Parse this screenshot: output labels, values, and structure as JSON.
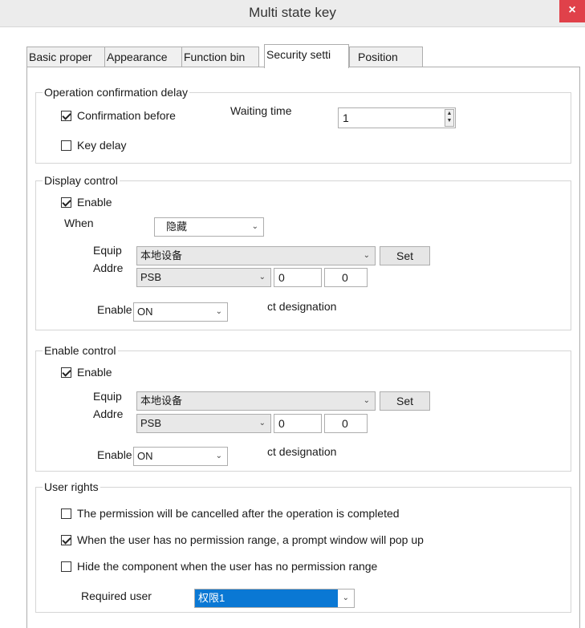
{
  "window": {
    "title": "Multi state key",
    "close_label": "×"
  },
  "tabs": [
    {
      "label": "Basic proper"
    },
    {
      "label": "Appearance"
    },
    {
      "label": "Function bin"
    },
    {
      "label": "Security setti"
    },
    {
      "label": "Position"
    }
  ],
  "operation": {
    "legend": "Operation confirmation delay",
    "confirm_label": "Confirmation before",
    "confirm_checked": true,
    "waiting_label": "Waiting time",
    "waiting_value": "1",
    "keydelay_label": "Key delay",
    "keydelay_checked": false
  },
  "display": {
    "legend": "Display control",
    "enable_label": "Enable",
    "enable_checked": true,
    "when_label": "When",
    "when_value": "隐藏",
    "equip_label": "Equip",
    "equip_value": "本地设备",
    "set_label": "Set",
    "addr_label": "Addre",
    "addr_type": "PSB",
    "addr_value1": "0",
    "addr_value2": "0",
    "state_label": "Enable sta",
    "state_value": "ON",
    "designation": "ct designation"
  },
  "enable_ctrl": {
    "legend": "Enable control",
    "enable_label": "Enable",
    "enable_checked": true,
    "equip_label": "Equip",
    "equip_value": "本地设备",
    "set_label": "Set",
    "addr_label": "Addre",
    "addr_type": "PSB",
    "addr_value1": "0",
    "addr_value2": "0",
    "state_label": "Enable sta",
    "state_value": "ON",
    "designation": "ct designation"
  },
  "user_rights": {
    "legend": "User rights",
    "opt1": "The permission will be cancelled after the operation is completed",
    "opt1_checked": false,
    "opt2": "When the user has no permission range, a prompt window will pop up",
    "opt2_checked": true,
    "opt3": "Hide the component when the user has no permission range",
    "opt3_checked": false,
    "required_label": "Required user",
    "required_value": "权限1"
  }
}
